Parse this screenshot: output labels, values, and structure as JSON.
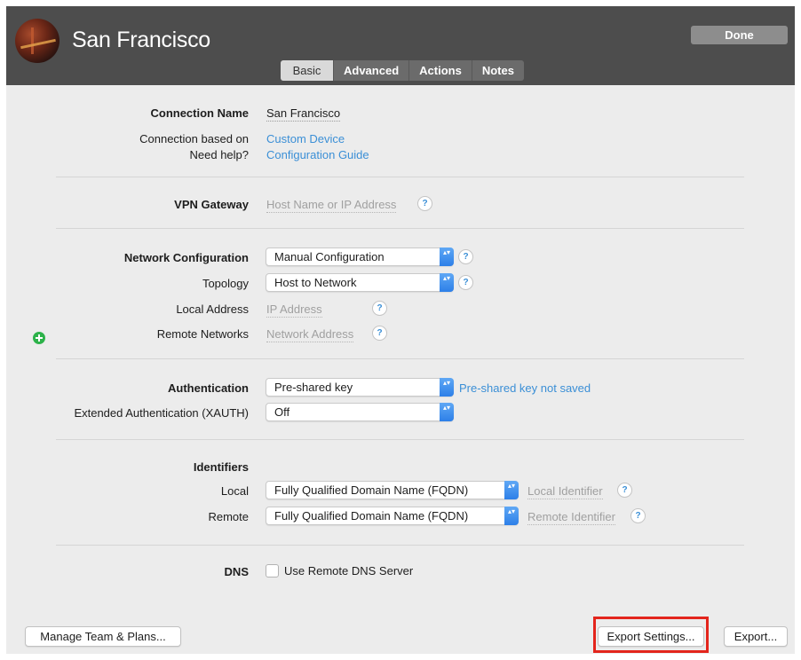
{
  "header": {
    "title": "San Francisco",
    "done_label": "Done",
    "tabs": [
      {
        "label": "Basic",
        "active": true
      },
      {
        "label": "Advanced",
        "active": false
      },
      {
        "label": "Actions",
        "active": false
      },
      {
        "label": "Notes",
        "active": false
      }
    ]
  },
  "connection": {
    "name_label": "Connection Name",
    "name_value": "San Francisco",
    "based_on_label": "Connection based on",
    "based_on_value": "Custom Device",
    "help_label": "Need help?",
    "help_link": "Configuration Guide"
  },
  "vpn_gateway": {
    "label": "VPN Gateway",
    "placeholder": "Host Name or IP Address"
  },
  "network": {
    "config_label": "Network Configuration",
    "config_value": "Manual Configuration",
    "topology_label": "Topology",
    "topology_value": "Host to Network",
    "local_address_label": "Local Address",
    "local_address_placeholder": "IP Address",
    "remote_networks_label": "Remote Networks",
    "remote_networks_placeholder": "Network Address"
  },
  "authentication": {
    "label": "Authentication",
    "value": "Pre-shared key",
    "status": "Pre-shared key not saved",
    "xauth_label": "Extended Authentication (XAUTH)",
    "xauth_value": "Off"
  },
  "identifiers": {
    "heading": "Identifiers",
    "local_label": "Local",
    "local_value": "Fully Qualified Domain Name (FQDN)",
    "local_placeholder": "Local Identifier",
    "remote_label": "Remote",
    "remote_value": "Fully Qualified Domain Name (FQDN)",
    "remote_placeholder": "Remote Identifier"
  },
  "dns": {
    "label": "DNS",
    "checkbox_label": "Use Remote DNS Server",
    "checked": false
  },
  "footer": {
    "manage_label": "Manage Team & Plans...",
    "export_settings_label": "Export Settings...",
    "export_label": "Export..."
  },
  "icons": {
    "help": "?",
    "select_arrow": "▴▾"
  },
  "colors": {
    "header_bg": "#4d4d4d",
    "content_bg": "#ececec",
    "link": "#3b8fd6",
    "highlight": "#e3251c",
    "add_icon": "#2db24a"
  }
}
